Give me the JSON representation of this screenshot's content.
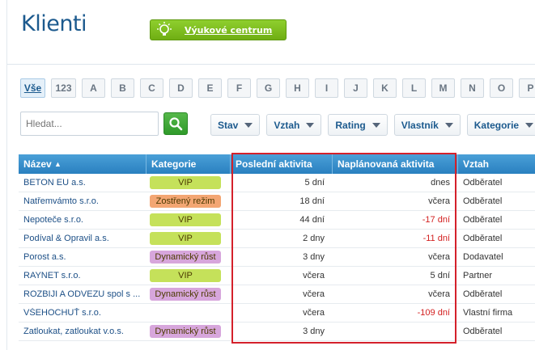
{
  "header": {
    "title": "Klienti",
    "learn_center": "Výukové centrum"
  },
  "alphabet": {
    "keys": [
      "Vše",
      "123",
      "A",
      "B",
      "C",
      "D",
      "E",
      "F",
      "G",
      "H",
      "I",
      "J",
      "K",
      "L",
      "M",
      "N",
      "O",
      "P"
    ],
    "active": "Vše"
  },
  "search": {
    "placeholder": "Hledat..."
  },
  "filters": [
    "Stav",
    "Vztah",
    "Rating",
    "Vlastník",
    "Kategorie"
  ],
  "table": {
    "columns": [
      "Název",
      "Kategorie",
      "Poslední aktivita",
      "Naplánovaná aktivita",
      "Vztah"
    ],
    "sort_indicator": "▲",
    "rows": [
      {
        "name": "BETON EU a.s.",
        "category": "VIP",
        "cat_color": "#c5e15a",
        "last": "5 dní",
        "planned": "dnes",
        "planned_neg": false,
        "relation": "Odběratel"
      },
      {
        "name": "Natřemvámto s.r.o.",
        "category": "Zostřený režim",
        "cat_color": "#f3a673",
        "last": "18 dní",
        "planned": "včera",
        "planned_neg": false,
        "relation": "Odběratel"
      },
      {
        "name": "Nepoteče s.r.o.",
        "category": "VIP",
        "cat_color": "#c5e15a",
        "last": "44 dní",
        "planned": "-17 dní",
        "planned_neg": true,
        "relation": "Odběratel"
      },
      {
        "name": "Podíval & Opravil a.s.",
        "category": "VIP",
        "cat_color": "#c5e15a",
        "last": "2 dny",
        "planned": "-11 dní",
        "planned_neg": true,
        "relation": "Odběratel"
      },
      {
        "name": "Porost a.s.",
        "category": "Dynamický růst",
        "cat_color": "#d7a6dc",
        "last": "3 dny",
        "planned": "včera",
        "planned_neg": false,
        "relation": "Dodavatel"
      },
      {
        "name": "RAYNET s.r.o.",
        "category": "VIP",
        "cat_color": "#c5e15a",
        "last": "včera",
        "planned": "5 dní",
        "planned_neg": false,
        "relation": "Partner"
      },
      {
        "name": "ROZBIJI A ODVEZU spol s ...",
        "category": "Dynamický růst",
        "cat_color": "#d7a6dc",
        "last": "včera",
        "planned": "včera",
        "planned_neg": false,
        "relation": "Odběratel"
      },
      {
        "name": "VŠEHOCHUŤ s.r.o.",
        "category": "",
        "cat_color": "",
        "last": "včera",
        "planned": "-109 dní",
        "planned_neg": true,
        "relation": "Vlastní firma"
      },
      {
        "name": "Zatloukat, zatloukat v.o.s.",
        "category": "Dynamický růst",
        "cat_color": "#d7a6dc",
        "last": "3 dny",
        "planned": "",
        "planned_neg": false,
        "relation": "Odběratel"
      }
    ]
  }
}
